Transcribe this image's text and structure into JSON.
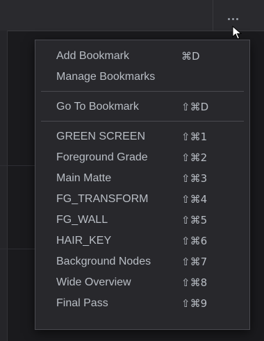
{
  "toolbar": {
    "more_icon": "more-horizontal-icon"
  },
  "menu": {
    "groups": [
      [
        {
          "label": "Add Bookmark",
          "shortcut": "⌘D"
        },
        {
          "label": "Manage Bookmarks",
          "shortcut": ""
        }
      ],
      [
        {
          "label": "Go To Bookmark",
          "shortcut": "⇧⌘D"
        }
      ],
      [
        {
          "label": "GREEN SCREEN",
          "shortcut": "⇧⌘1"
        },
        {
          "label": "Foreground Grade",
          "shortcut": "⇧⌘2"
        },
        {
          "label": "Main Matte",
          "shortcut": "⇧⌘3"
        },
        {
          "label": "FG_TRANSFORM",
          "shortcut": "⇧⌘4"
        },
        {
          "label": "FG_WALL",
          "shortcut": "⇧⌘5"
        },
        {
          "label": "HAIR_KEY",
          "shortcut": "⇧⌘6"
        },
        {
          "label": "Background Nodes",
          "shortcut": "⇧⌘7"
        },
        {
          "label": "Wide Overview",
          "shortcut": "⇧⌘8"
        },
        {
          "label": "Final Pass",
          "shortcut": "⇧⌘9"
        }
      ]
    ]
  },
  "colors": {
    "menu_background": "#28282c",
    "menu_text": "#b9bec5",
    "separator": "#4a4a50"
  }
}
